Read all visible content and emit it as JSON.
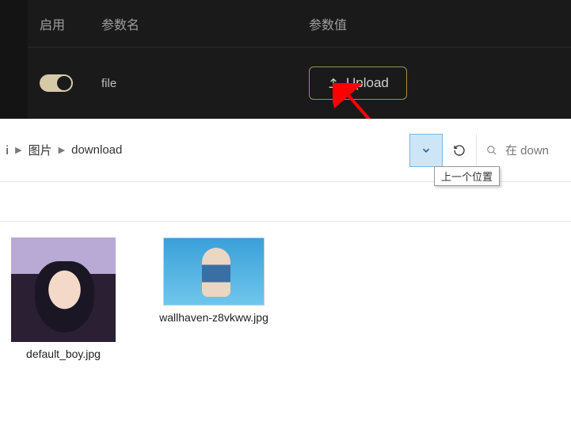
{
  "table": {
    "headers": {
      "enable": "启用",
      "name": "参数名",
      "value": "参数值"
    },
    "row": {
      "name": "file",
      "upload_label": "Upload"
    }
  },
  "explorer": {
    "crumbs": [
      "图片",
      "download"
    ],
    "crumb_prefix": "ⅰ",
    "tooltip": "上一个位置",
    "search_hint": "在 down",
    "files": [
      {
        "name": "default_boy.jpg"
      },
      {
        "name": "wallhaven-z8vkww.jpg"
      }
    ]
  }
}
